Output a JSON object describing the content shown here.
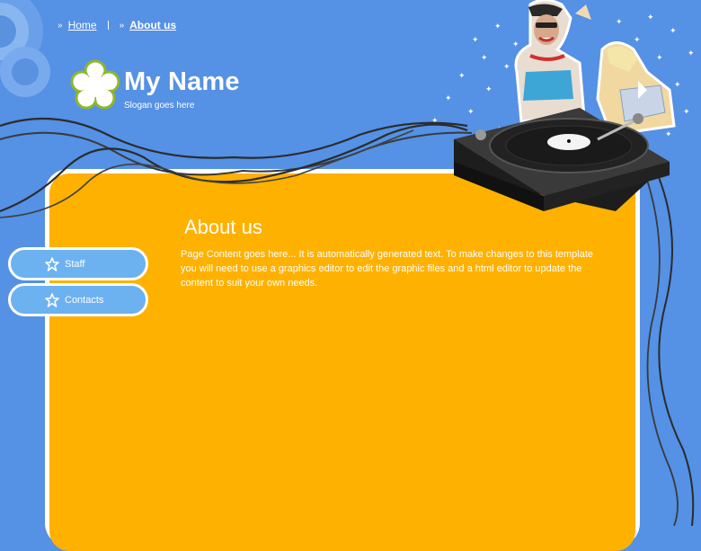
{
  "breadcrumb": {
    "items": [
      {
        "label": "Home",
        "active": false
      },
      {
        "label": "About us",
        "active": true
      }
    ]
  },
  "header": {
    "title": "My Name",
    "slogan": "Slogan goes here"
  },
  "sidebar": {
    "items": [
      {
        "label": "Staff",
        "icon": "star-icon"
      },
      {
        "label": "Contacts",
        "icon": "star-icon"
      }
    ]
  },
  "main": {
    "heading": "About us",
    "body": "Page Content goes here... It is automatically generated text. To make changes to this template you will need to use a graphics editor to edit the graphic files and a html editor to update the content to suit your own needs."
  },
  "colors": {
    "background": "#5591e4",
    "content_panel": "#ffb100",
    "sidebar_button": "#6db2f0",
    "logo_flower": "#ffffff",
    "logo_outline": "#8fb82a"
  }
}
